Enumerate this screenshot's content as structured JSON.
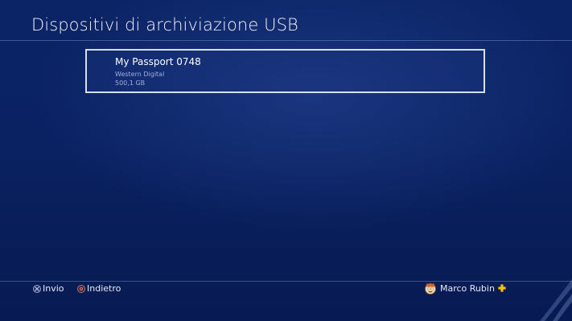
{
  "header": {
    "title": "Dispositivi di archiviazione USB"
  },
  "devices": [
    {
      "name": "My Passport 0748",
      "manufacturer": "Western Digital",
      "capacity": "500,1 GB"
    }
  ],
  "footer": {
    "enter_label": "Invio",
    "back_label": "Indietro",
    "enter_icon": "cross-button-icon",
    "back_icon": "circle-button-icon"
  },
  "user": {
    "name": "Marco Rubin",
    "avatar_icon": "avatar-icon",
    "plus_icon": "ps-plus-icon",
    "plus_color": "#f5c400"
  },
  "colors": {
    "background": "#0a2262",
    "selection_border": "#d8def0",
    "secondary_text": "#9fb0d8"
  }
}
